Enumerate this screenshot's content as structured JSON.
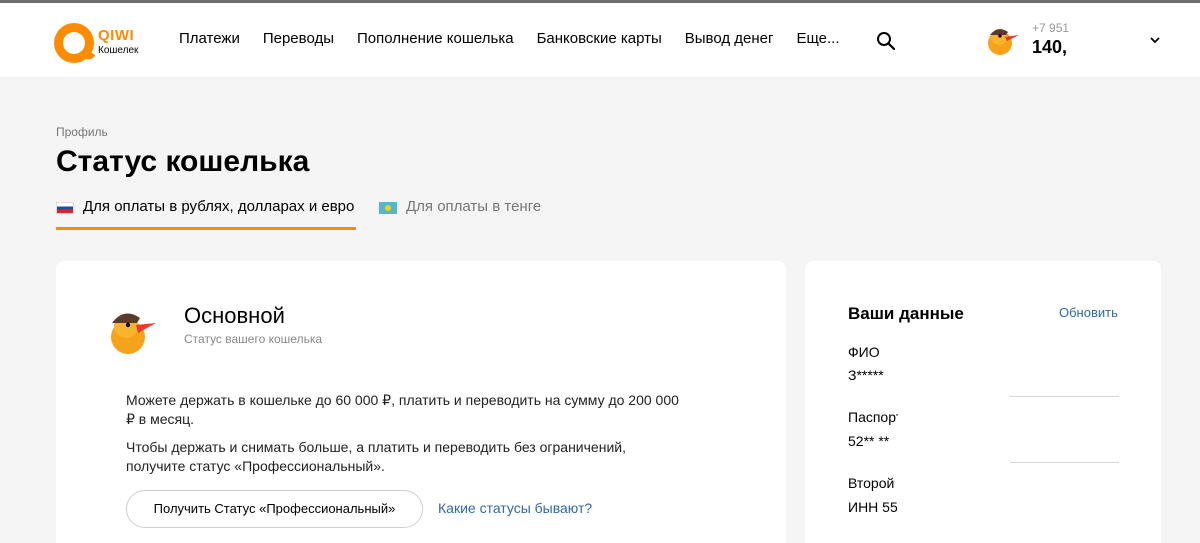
{
  "header": {
    "logo_brand": "QIWI",
    "logo_sub": "Кошелек",
    "nav": [
      "Платежи",
      "Переводы",
      "Пополнение кошелька",
      "Банковские карты",
      "Вывод денег",
      "Еще..."
    ],
    "search_icon": "search-icon",
    "user": {
      "phone": "+7 951",
      "balance": "140,",
      "avatar_icon": "duck-avatar-icon",
      "dropdown_icon": "chevron-down-icon"
    }
  },
  "page": {
    "breadcrumb": "Профиль",
    "title": "Статус кошелька",
    "tabs": [
      {
        "label": "Для оплаты в рублях, долларах и евро",
        "flag": "russia-flag-icon",
        "active": true
      },
      {
        "label": "Для оплаты в тенге",
        "flag": "kazakhstan-flag-icon",
        "active": false
      }
    ]
  },
  "status_card": {
    "name": "Основной",
    "subtitle": "Статус вашего кошелька",
    "text1": "Можете держать в кошельке до 60 000 ₽, платить и переводить на сумму до 200 000 ₽ в месяц.",
    "text2": "Чтобы держать и снимать больше, а платить и переводить без ограничений, получите статус «Профессиональный».",
    "button_label": "Получить Статус «Профессиональный»",
    "link_label": "Какие статусы бывают?"
  },
  "data_card": {
    "title": "Ваши данные",
    "refresh_label": "Обновить",
    "fields": [
      {
        "label": "ФИО",
        "value": "З***** "
      },
      {
        "label": "Паспорт",
        "value": "52** **"
      },
      {
        "label": "Второй",
        "value": "ИНН 55"
      }
    ]
  },
  "colors": {
    "accent": "#ff8c00",
    "link": "#2f69a9",
    "background": "#f5f5f5"
  }
}
